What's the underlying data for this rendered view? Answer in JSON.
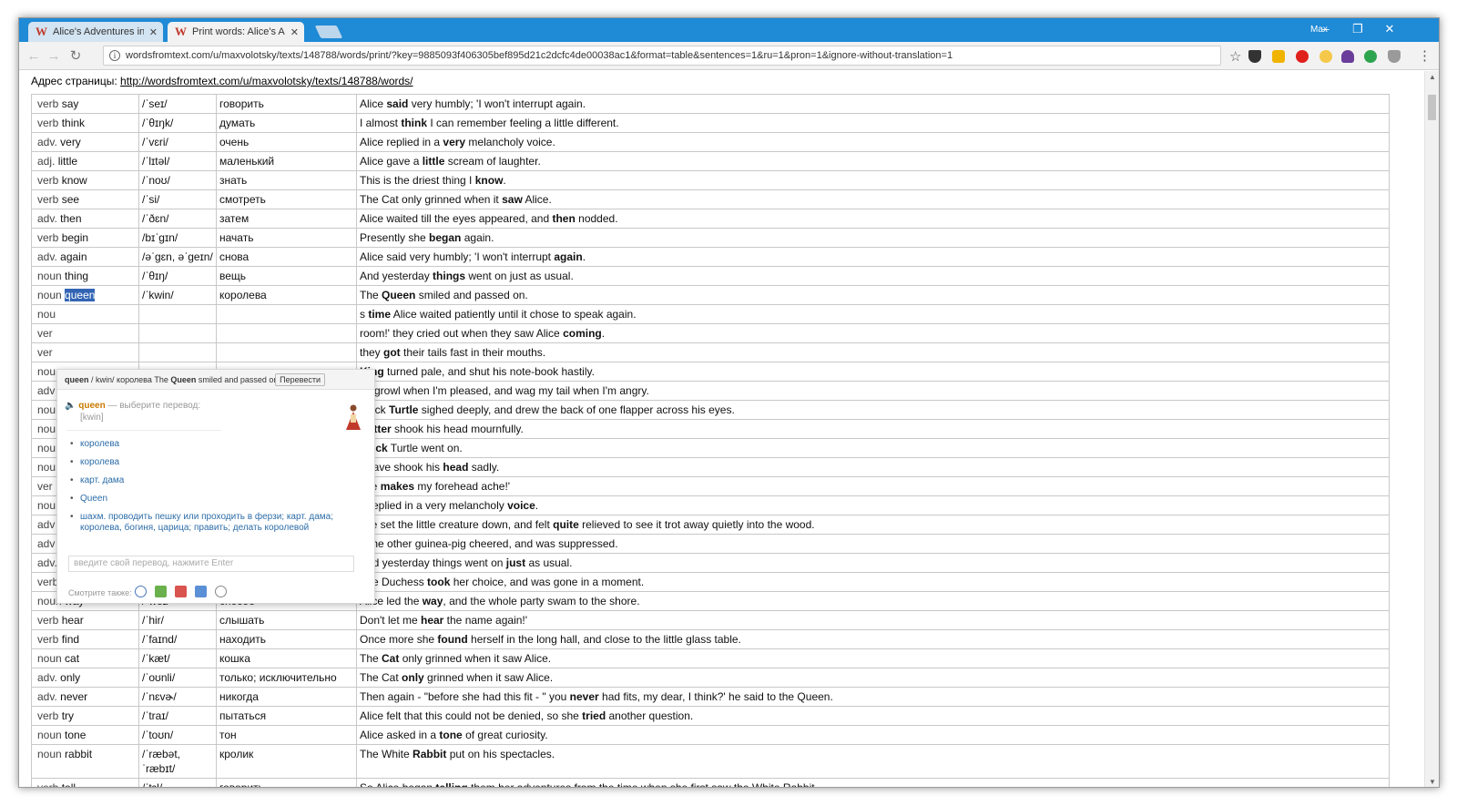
{
  "tabs": [
    {
      "title": "Alice's Adventures in Wo",
      "icon": "W"
    },
    {
      "title": "Print words: Alice's Adve",
      "icon": "W"
    }
  ],
  "window": {
    "user": "Max",
    "minimize": "–",
    "restore": "❐",
    "close": "✕"
  },
  "toolbar": {
    "back": "←",
    "forward": "→",
    "reload": "↻",
    "url": "wordsfromtext.com/u/maxvolotsky/texts/148788/words/print/?key=9885093f406305bef895d21c2dcfc4de00038ac1&format=table&sentences=1&ru=1&pron=1&ignore-without-translation=1",
    "star": "☆",
    "menu": "⋮"
  },
  "page": {
    "address_label": "Адрес страницы: ",
    "address_link": "http://wordsfromtext.com/u/maxvolotsky/texts/148788/words/"
  },
  "words": [
    {
      "pos": "verb",
      "word": "say",
      "pron": "/ˈseɪ/",
      "ru": "говорить",
      "s_pre": "Alice ",
      "s_bold": "said",
      "s_post": " very humbly; 'I won't interrupt again."
    },
    {
      "pos": "verb",
      "word": "think",
      "pron": "/ˈθɪŋk/",
      "ru": "думать",
      "s_pre": "I almost ",
      "s_bold": "think",
      "s_post": " I can remember feeling a little different."
    },
    {
      "pos": "adv.",
      "word": "very",
      "pron": "/ˈvɛri/",
      "ru": "очень",
      "s_pre": "Alice replied in a ",
      "s_bold": "very",
      "s_post": " melancholy voice."
    },
    {
      "pos": "adj.",
      "word": "little",
      "pron": "/ˈlɪtəl/",
      "ru": "маленький",
      "s_pre": "Alice gave a ",
      "s_bold": "little",
      "s_post": " scream of laughter."
    },
    {
      "pos": "verb",
      "word": "know",
      "pron": "/ˈnoʊ/",
      "ru": "знать",
      "s_pre": "This is the driest thing I ",
      "s_bold": "know",
      "s_post": "."
    },
    {
      "pos": "verb",
      "word": "see",
      "pron": "/ˈsi/",
      "ru": "смотреть",
      "s_pre": "The Cat only grinned when it ",
      "s_bold": "saw",
      "s_post": " Alice."
    },
    {
      "pos": "adv.",
      "word": "then",
      "pron": "/ˈðɛn/",
      "ru": "затем",
      "s_pre": "Alice waited till the eyes appeared, and ",
      "s_bold": "then",
      "s_post": " nodded."
    },
    {
      "pos": "verb",
      "word": "begin",
      "pron": "/bɪˈgɪn/",
      "ru": "начать",
      "s_pre": "Presently she ",
      "s_bold": "began",
      "s_post": " again."
    },
    {
      "pos": "adv.",
      "word": "again",
      "pron": "/əˈgɛn, əˈgeɪn/",
      "ru": "снова",
      "s_pre": "Alice said very humbly; 'I won't interrupt ",
      "s_bold": "again",
      "s_post": "."
    },
    {
      "pos": "noun",
      "word": "thing",
      "pron": "/ˈθɪŋ/",
      "ru": "вещь",
      "s_pre": "And yesterday ",
      "s_bold": "things",
      "s_post": " went on just as usual."
    },
    {
      "pos": "noun",
      "word": "queen",
      "pron": "/ˈkwin/",
      "ru": "королева",
      "s_pre": "The ",
      "s_bold": "Queen",
      "s_post": " smiled and passed on.",
      "highlight": true
    },
    {
      "pos": "nou",
      "word": "",
      "pron": "",
      "ru": "",
      "s_pre": "s ",
      "s_bold": "time",
      "s_post": " Alice waited patiently until it chose to speak again."
    },
    {
      "pos": "ver",
      "word": "",
      "pron": "",
      "ru": "",
      "s_pre": "room!' they cried out when they saw Alice ",
      "s_bold": "coming",
      "s_post": "."
    },
    {
      "pos": "ver",
      "word": "",
      "pron": "",
      "ru": "",
      "s_pre": "they ",
      "s_bold": "got",
      "s_post": " their tails fast in their mouths."
    },
    {
      "pos": "nou",
      "word": "",
      "pron": "",
      "ru": "",
      "s_pre": " ",
      "s_bold": "King",
      "s_post": " turned pale, and shut his note-book hastily."
    },
    {
      "pos": "adv",
      "word": "",
      "pron": "",
      "ru": "",
      "s_pre": "v I growl when I'm pleased, and wag my tail when I'm angry.",
      "s_bold": "",
      "s_post": ""
    },
    {
      "pos": "nou",
      "word": "",
      "pron": "",
      "ru": "",
      "s_pre": " Mock ",
      "s_bold": "Turtle",
      "s_post": " sighed deeply, and drew the back of one flapper across his eyes."
    },
    {
      "pos": "nou",
      "word": "",
      "pron": "",
      "ru": "",
      "s_pre": " ",
      "s_bold": "Hatter",
      "s_post": " shook his head mournfully."
    },
    {
      "pos": "nou",
      "word": "",
      "pron": "",
      "ru": "",
      "s_pre": " ",
      "s_bold": "Mock",
      "s_post": " Turtle went on."
    },
    {
      "pos": "nou",
      "word": "",
      "pron": "",
      "ru": "",
      "s_pre": " Knave shook his ",
      "s_bold": "head",
      "s_post": " sadly."
    },
    {
      "pos": "ver",
      "word": "",
      "pron": "",
      "ru": "",
      "s_pre": "uite ",
      "s_bold": "makes",
      "s_post": " my forehead ache!'"
    },
    {
      "pos": "nou",
      "word": "",
      "pron": "",
      "ru": "",
      "s_pre": "e replied in a very melancholy ",
      "s_bold": "voice",
      "s_post": "."
    },
    {
      "pos": "adv",
      "word": "",
      "pron": "",
      "ru": "",
      "s_pre": "she set the little creature down, and felt ",
      "s_bold": "quite",
      "s_post": " relieved to see it trot away quietly into the wood."
    },
    {
      "pos": "adv",
      "word": "",
      "pron": "",
      "ru": "",
      "s_pre": "",
      "s_bold": "e",
      "s_post": " the other guinea-pig cheered, and was suppressed."
    },
    {
      "pos": "adv.",
      "word": "just",
      "pron": "/ˈdʒʌst, dʒɪst/",
      "ru": "точно; только что",
      "s_pre": "And yesterday things went on ",
      "s_bold": "just",
      "s_post": " as usual."
    },
    {
      "pos": "verb",
      "word": "take",
      "pron": "/ˈteɪk/",
      "ru": "брать",
      "s_pre": "The Duchess ",
      "s_bold": "took",
      "s_post": " her choice, and was gone in a moment."
    },
    {
      "pos": "noun",
      "word": "way",
      "pron": "/ˈweɪ/",
      "ru": "способ",
      "s_pre": "Alice led the ",
      "s_bold": "way",
      "s_post": ", and the whole party swam to the shore."
    },
    {
      "pos": "verb",
      "word": "hear",
      "pron": "/ˈhir/",
      "ru": "слышать",
      "s_pre": "Don't let me ",
      "s_bold": "hear",
      "s_post": " the name again!'"
    },
    {
      "pos": "verb",
      "word": "find",
      "pron": "/ˈfaɪnd/",
      "ru": "находить",
      "s_pre": "Once more she ",
      "s_bold": "found",
      "s_post": " herself in the long hall, and close to the little glass table."
    },
    {
      "pos": "noun",
      "word": "cat",
      "pron": "/ˈkæt/",
      "ru": "кошка",
      "s_pre": "The ",
      "s_bold": "Cat",
      "s_post": " only grinned when it saw Alice."
    },
    {
      "pos": "adv.",
      "word": "only",
      "pron": "/ˈoʊnli/",
      "ru": "только; исключительно",
      "s_pre": "The Cat ",
      "s_bold": "only",
      "s_post": " grinned when it saw Alice."
    },
    {
      "pos": "adv.",
      "word": "never",
      "pron": "/ˈnɛvɚ/",
      "ru": "никогда",
      "s_pre": "Then again - \"before she had this fit - \" you ",
      "s_bold": "never",
      "s_post": " had fits, my dear, I think?' he said to the Queen."
    },
    {
      "pos": "verb",
      "word": "try",
      "pron": "/ˈtraɪ/",
      "ru": "пытаться",
      "s_pre": "Alice felt that this could not be denied, so she ",
      "s_bold": "tried",
      "s_post": " another question."
    },
    {
      "pos": "noun",
      "word": "tone",
      "pron": "/ˈtoʊn/",
      "ru": "тон",
      "s_pre": "Alice asked in a ",
      "s_bold": "tone",
      "s_post": " of great curiosity."
    },
    {
      "pos": "noun",
      "word": "rabbit",
      "pron": "/ˈræbət, ˈræbɪt/",
      "ru": "кролик",
      "s_pre": "The White ",
      "s_bold": "Rabbit",
      "s_post": " put on his spectacles."
    },
    {
      "pos": "verb",
      "word": "tell",
      "pron": "/ˈtɛl/",
      "ru": "говорить",
      "s_pre": "So Alice began ",
      "s_bold": "telling",
      "s_post": " them her adventures from the time when she first saw the White Rabbit."
    }
  ],
  "popup": {
    "head_word": "queen",
    "head_pron": " / kwin/ ",
    "head_ru": "королева",
    "head_s_pre": " The ",
    "head_s_bold": "Queen",
    "head_s_post": " smiled and passed on.",
    "translate_button": "Перевести",
    "word": "queen",
    "choose_hint": " — выберите перевод:",
    "transcription": "[kwin]",
    "translations": [
      "королева",
      "королева",
      "карт. дама",
      "Queen",
      "шахм. проводить пешку или проходить в ферзи; карт. дама; королева, богиня, царица; править; делать королевой"
    ],
    "input_placeholder": "введите свой перевод, нажмите Enter",
    "see_also": "Смотрите также:"
  },
  "colors": {
    "titlebar": "#1f8ad6",
    "highlight": "#3264b4",
    "popup_word": "#c87a00",
    "popup_link": "#2c6da8"
  }
}
